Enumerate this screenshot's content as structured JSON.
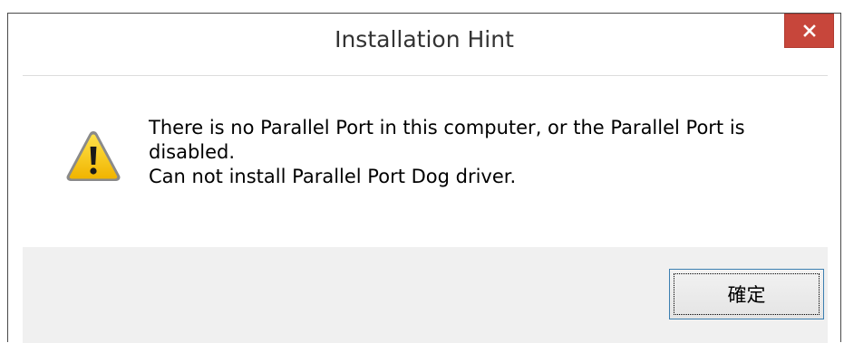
{
  "dialog": {
    "title": "Installation Hint",
    "close_icon": "close-icon",
    "warning_icon": "warning-triangle-icon",
    "message_lines": [
      "There is no Parallel Port in this computer, or the Parallel Port is",
      "disabled.",
      "Can not install Parallel Port Dog driver."
    ],
    "ok_label": "確定"
  },
  "colors": {
    "close_button": "#c7463b",
    "footer_background": "#f0f0f0",
    "button_border": "#3c7fb1",
    "warning_fill": "#f5c400"
  }
}
